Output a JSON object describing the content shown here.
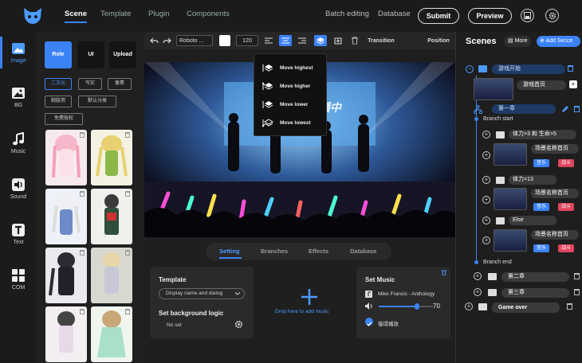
{
  "topbar": {
    "tabs": [
      {
        "label": "Scene",
        "active": true
      },
      {
        "label": "Template",
        "active": false
      },
      {
        "label": "Plugin",
        "active": false
      },
      {
        "label": "Components",
        "active": false
      }
    ],
    "batch_label": "Batch editing",
    "database_label": "Database",
    "submit_label": "Submit",
    "preview_label": "Preview"
  },
  "leftnav": [
    {
      "label": "Image",
      "icon": "image-icon",
      "active": true
    },
    {
      "label": "BG",
      "icon": "background-icon",
      "active": false
    },
    {
      "label": "Music",
      "icon": "music-icon",
      "active": false
    },
    {
      "label": "Sound",
      "icon": "sound-icon",
      "active": false
    },
    {
      "label": "Text",
      "icon": "text-icon",
      "active": false
    },
    {
      "label": "COM",
      "icon": "components-icon",
      "active": false
    }
  ],
  "assets": {
    "categories": [
      {
        "label": "Role",
        "active": true
      },
      {
        "label": "UI",
        "active": false
      },
      {
        "label": "Upload",
        "active": false
      }
    ],
    "tags": [
      {
        "label": "二次元",
        "active": true
      },
      {
        "label": "写实",
        "active": false
      },
      {
        "label": "像素",
        "active": false
      },
      {
        "label": "腕肢用",
        "active": false
      },
      {
        "label": "默认分类",
        "active": false
      },
      {
        "label": "免费版权",
        "active": false
      }
    ]
  },
  "toolbar": {
    "font": "Roboto ...",
    "font_size": "120",
    "transition_label": "Transition",
    "position_label": "Position"
  },
  "layer_menu": [
    "Move highest",
    "Move higher",
    "Move lower",
    "Move lowest"
  ],
  "stage": {
    "banner": "直播中"
  },
  "bottom": {
    "tabs": [
      {
        "label": "Setting",
        "active": true
      },
      {
        "label": "Branches",
        "active": false
      },
      {
        "label": "Effects",
        "active": false
      },
      {
        "label": "Database",
        "active": false
      }
    ],
    "template_title": "Template",
    "template_value": "Display name and dialog",
    "bg_logic_title": "Set background logic",
    "bg_logic_value": "No set",
    "drop_text": "Drop here to add music",
    "music_title": "Set Music",
    "music_track": "Mike Francis - Anthology",
    "volume": "70",
    "volume_level": 0.7,
    "loop_label": "循環播放"
  },
  "scenes": {
    "title": "Scenes",
    "more_label": "More",
    "add_label": "Add Secce",
    "group1": "游戏开始",
    "first_scene": "游戏首页",
    "chapter1": "第一章",
    "branch_start": "Branch start",
    "cond1": "体力>3 和 生命>5",
    "cond2": "体力=13",
    "else_label": "Else",
    "scene_title": "场景名称首页",
    "badge_music": "音乐",
    "badge_fight": "战斗",
    "branch_end": "Branch end",
    "chapter2": "第二章",
    "chapter3": "第三章",
    "game_over": "Game over"
  },
  "colors": {
    "accent": "#3b82f6",
    "dark": "#1b1b1b",
    "badge_red": "#e0445f"
  }
}
